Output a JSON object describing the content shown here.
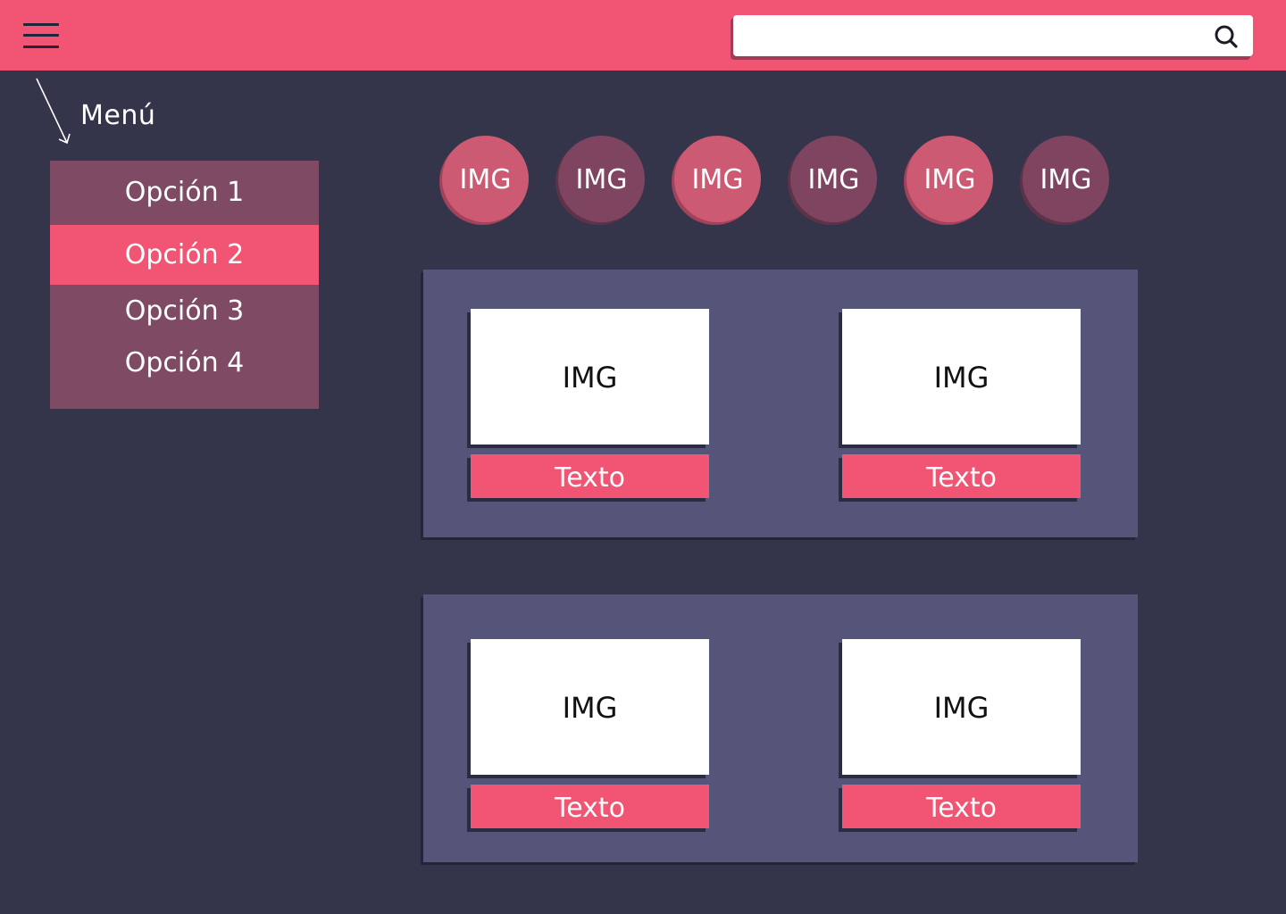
{
  "header": {
    "menu_icon": "hamburger-menu-icon",
    "search": {
      "value": "",
      "placeholder": "",
      "icon": "search-icon"
    }
  },
  "annotation": {
    "menu_label": "Menú",
    "arrow_icon": "arrow-down-right-icon"
  },
  "sidebar": {
    "items": [
      {
        "label": "Opción 1",
        "active": false
      },
      {
        "label": "Opción 2",
        "active": true
      },
      {
        "label": "Opción 3",
        "active": false
      },
      {
        "label": "Opción 4",
        "active": false
      }
    ]
  },
  "circles": [
    {
      "label": "IMG",
      "tone": "light"
    },
    {
      "label": "IMG",
      "tone": "dark"
    },
    {
      "label": "IMG",
      "tone": "light"
    },
    {
      "label": "IMG",
      "tone": "dark"
    },
    {
      "label": "IMG",
      "tone": "light"
    },
    {
      "label": "IMG",
      "tone": "dark"
    }
  ],
  "panels": [
    {
      "cards": [
        {
          "image_label": "IMG",
          "text": "Texto"
        },
        {
          "image_label": "IMG",
          "text": "Texto"
        }
      ]
    },
    {
      "cards": [
        {
          "image_label": "IMG",
          "text": "Texto"
        },
        {
          "image_label": "IMG",
          "text": "Texto"
        }
      ]
    }
  ],
  "colors": {
    "background": "#34354a",
    "accent": "#f25573",
    "menu": "#7f4a63",
    "panel": "#55557a",
    "circle_light": "#cc5a72",
    "circle_dark": "#7f4560"
  }
}
